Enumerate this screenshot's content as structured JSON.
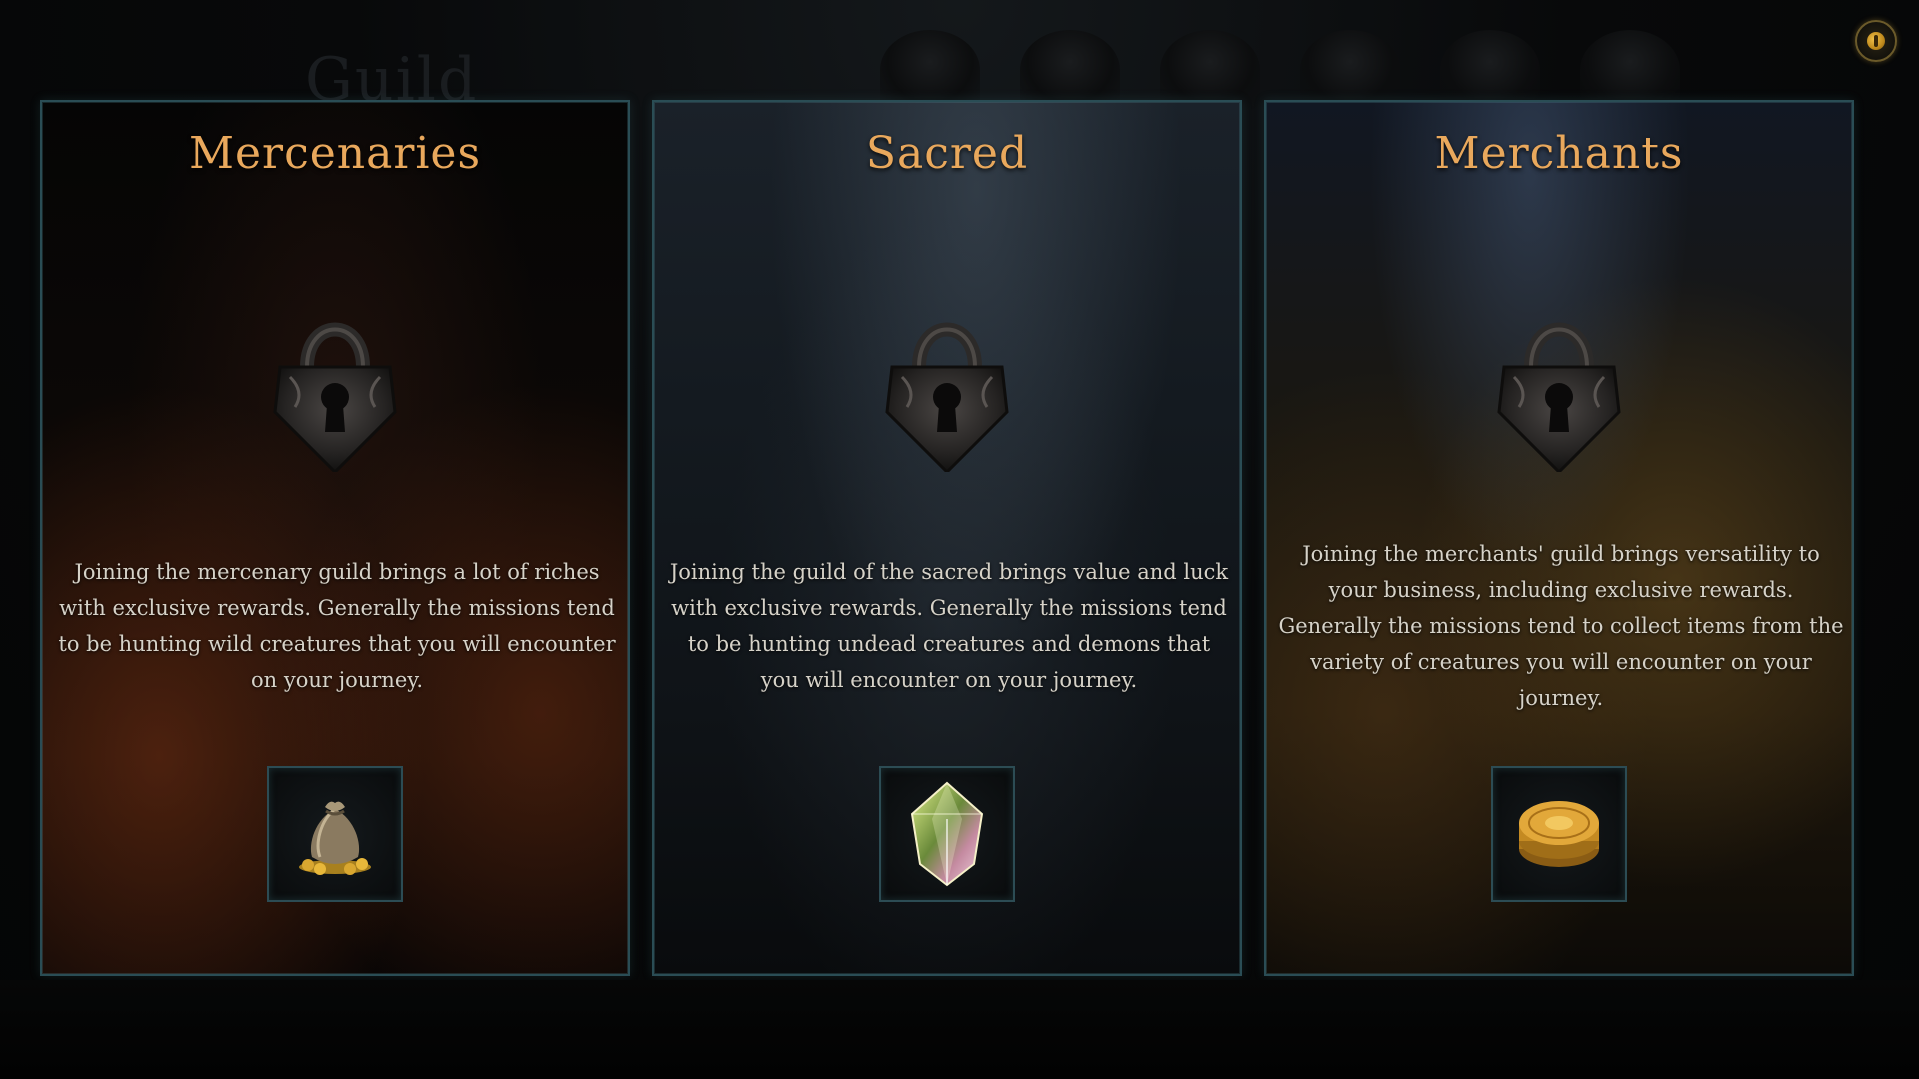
{
  "background": {
    "title": "Guild"
  },
  "settings": {
    "icon": "settings-coin-icon"
  },
  "guilds": [
    {
      "title": "Mercenaries",
      "lock_icon": "padlock-icon",
      "description": "Joining the mercenary guild brings a lot of riches with exclusive rewards. Generally the missions tend to be hunting wild creatures that you will encounter on your journey.",
      "reward_icon": "gold-pouch-icon"
    },
    {
      "title": "Sacred",
      "lock_icon": "padlock-icon",
      "description": "Joining the guild of the sacred brings value and luck with exclusive rewards. Generally the missions tend to be hunting undead creatures and demons that you will encounter on your journey.",
      "reward_icon": "crystal-gem-icon"
    },
    {
      "title": "Merchants",
      "lock_icon": "padlock-icon",
      "description": "Joining the merchants' guild brings versatility to your business, including exclusive rewards. Generally the missions tend to collect items from the variety of creatures you will encounter on your journey.",
      "reward_icon": "gold-coins-icon"
    }
  ],
  "colors": {
    "title": "#e9a85c",
    "border": "#2a4d55",
    "text": "#d6d2c8"
  }
}
